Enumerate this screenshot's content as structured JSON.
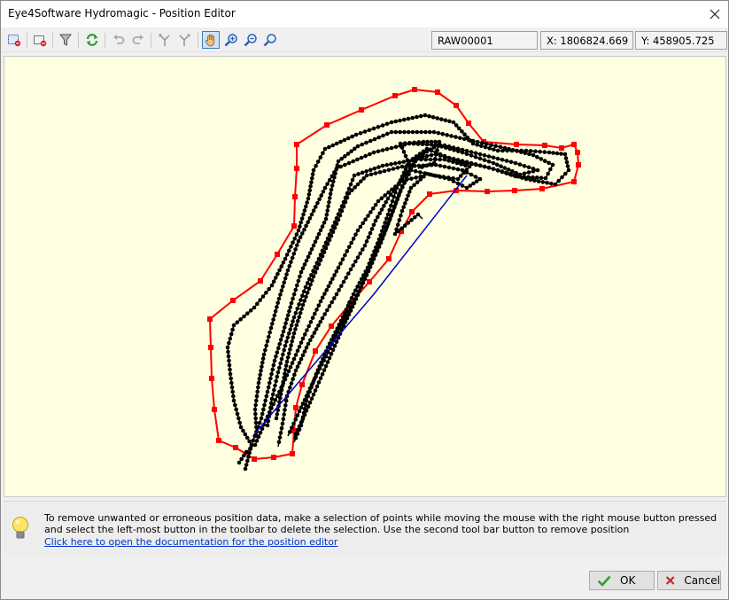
{
  "window": {
    "title": "Eye4Software Hydromagic - Position Editor"
  },
  "toolbar": {
    "buttons": [
      {
        "name": "delete-selection",
        "icon": "select-delete-icon"
      },
      {
        "name": "remove-position",
        "icon": "remove-point-icon"
      },
      {
        "name": "filter",
        "icon": "funnel-icon"
      },
      {
        "name": "refresh",
        "icon": "refresh-icon"
      },
      {
        "name": "undo",
        "icon": "undo-icon"
      },
      {
        "name": "redo",
        "icon": "redo-icon"
      },
      {
        "name": "split-left",
        "icon": "split-left-icon"
      },
      {
        "name": "split-right",
        "icon": "split-right-icon"
      },
      {
        "name": "pan",
        "icon": "hand-icon"
      },
      {
        "name": "zoom-in",
        "icon": "zoom-in-icon"
      },
      {
        "name": "zoom-out",
        "icon": "zoom-out-icon"
      },
      {
        "name": "zoom-extents",
        "icon": "zoom-extents-icon"
      }
    ],
    "file_name": "RAW00001",
    "x_coord": "X: 1806824.669",
    "y_coord": "Y: 458905.725"
  },
  "colors": {
    "canvas_bg": "#ffffe1",
    "track": "#000000",
    "track_line": "#0000cc",
    "selection": "#ff0000"
  },
  "info": {
    "text": "To remove unwanted or erroneous position data, make a selection of points while moving the mouse with the right mouse button pressed and select the left-most button in the toolbar to delete the selection. Use the second tool bar button to remove position",
    "link": "Click here to open the documentation for the position editor"
  },
  "buttons": {
    "ok": "OK",
    "cancel": "Cancel"
  }
}
